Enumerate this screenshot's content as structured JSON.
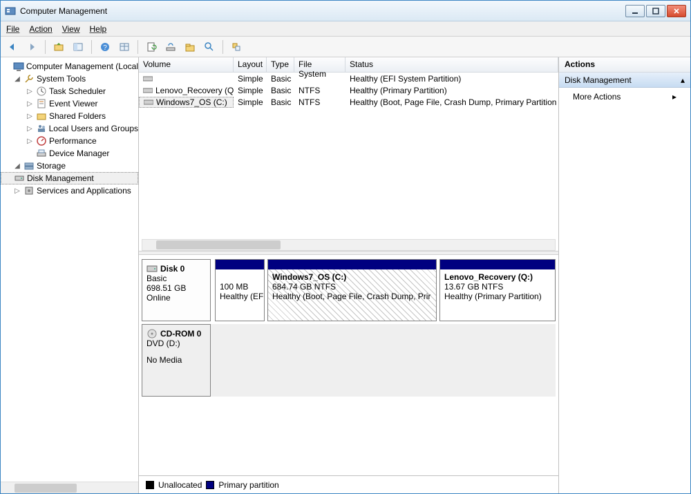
{
  "window": {
    "title": "Computer Management"
  },
  "menu": {
    "file": "File",
    "action": "Action",
    "view": "View",
    "help": "Help"
  },
  "tree": {
    "root": "Computer Management (Local",
    "system_tools": "System Tools",
    "task_scheduler": "Task Scheduler",
    "event_viewer": "Event Viewer",
    "shared_folders": "Shared Folders",
    "local_users": "Local Users and Groups",
    "performance": "Performance",
    "device_manager": "Device Manager",
    "storage": "Storage",
    "disk_management": "Disk Management",
    "services_apps": "Services and Applications"
  },
  "volumes": {
    "headers": {
      "volume": "Volume",
      "layout": "Layout",
      "type": "Type",
      "fs": "File System",
      "status": "Status"
    },
    "rows": [
      {
        "name": "",
        "layout": "Simple",
        "type": "Basic",
        "fs": "",
        "status": "Healthy (EFI System Partition)"
      },
      {
        "name": "Lenovo_Recovery (Q:)",
        "layout": "Simple",
        "type": "Basic",
        "fs": "NTFS",
        "status": "Healthy (Primary Partition)"
      },
      {
        "name": "Windows7_OS (C:)",
        "layout": "Simple",
        "type": "Basic",
        "fs": "NTFS",
        "status": "Healthy (Boot, Page File, Crash Dump, Primary Partition"
      }
    ]
  },
  "disks": {
    "disk0": {
      "title": "Disk 0",
      "line1": "Basic",
      "line2": "698.51 GB",
      "line3": "Online",
      "parts": [
        {
          "title": "",
          "line1": "100 MB",
          "line2": "Healthy (EFI"
        },
        {
          "title": "Windows7_OS  (C:)",
          "line1": "684.74 GB NTFS",
          "line2": "Healthy (Boot, Page File, Crash Dump, Prir"
        },
        {
          "title": "Lenovo_Recovery  (Q:)",
          "line1": "13.67 GB NTFS",
          "line2": "Healthy (Primary Partition)"
        }
      ]
    },
    "cdrom": {
      "title": "CD-ROM 0",
      "line1": "DVD (D:)",
      "line2": "No Media"
    }
  },
  "legend": {
    "unallocated": "Unallocated",
    "primary": "Primary partition"
  },
  "actions": {
    "header": "Actions",
    "section": "Disk Management",
    "more": "More Actions"
  }
}
